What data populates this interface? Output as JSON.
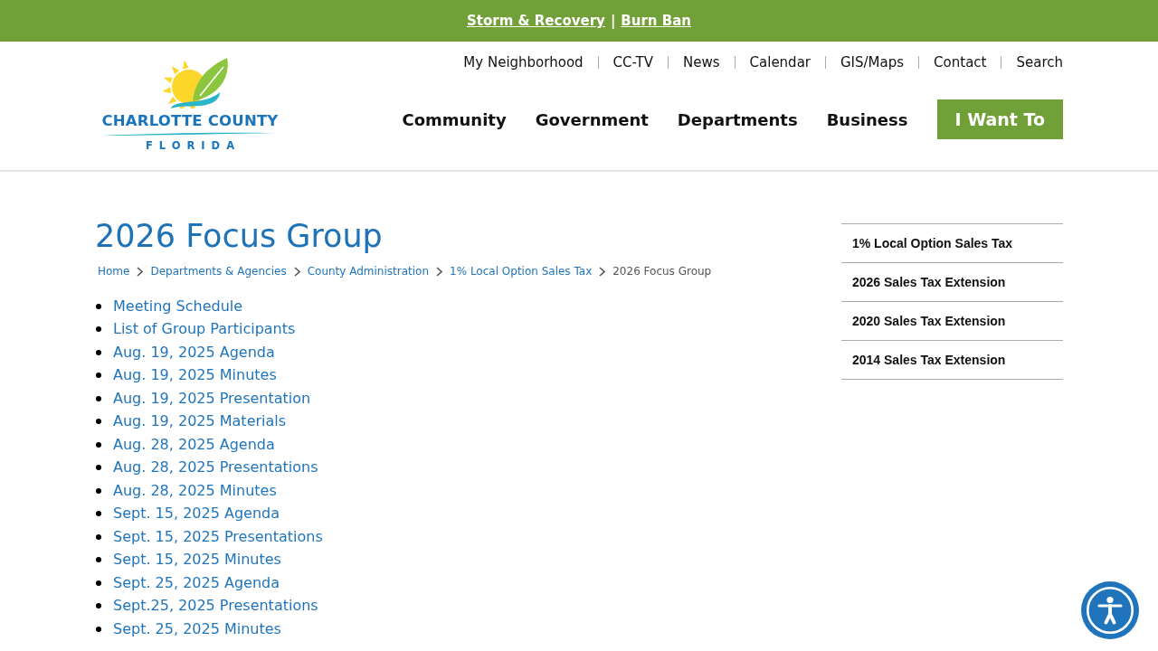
{
  "alert_bar": {
    "links": [
      "Storm & Recovery",
      "Burn Ban"
    ],
    "separator": "|"
  },
  "logo": {
    "name": "CHARLOTTE COUNTY",
    "state": "FLORIDA"
  },
  "utility_nav": [
    "My Neighborhood",
    "CC-TV",
    "News",
    "Calendar",
    "GIS/Maps",
    "Contact",
    "Search"
  ],
  "main_nav": [
    {
      "label": "Community",
      "kind": "link"
    },
    {
      "label": "Government",
      "kind": "link"
    },
    {
      "label": "Departments",
      "kind": "link"
    },
    {
      "label": "Business",
      "kind": "link"
    },
    {
      "label": "I Want To",
      "kind": "button"
    }
  ],
  "page": {
    "title": "2026 Focus Group",
    "breadcrumb": [
      {
        "label": "Home",
        "current": false
      },
      {
        "label": "Departments & Agencies",
        "current": false
      },
      {
        "label": "County Administration",
        "current": false
      },
      {
        "label": "1% Local Option Sales Tax",
        "current": false
      },
      {
        "label": "2026 Focus Group",
        "current": true
      }
    ],
    "links": [
      "Meeting Schedule",
      "List of Group Participants",
      "Aug. 19, 2025 Agenda",
      "Aug. 19, 2025 Minutes",
      "Aug. 19, 2025 Presentation",
      "Aug. 19, 2025 Materials",
      "Aug. 28, 2025 Agenda",
      "Aug. 28, 2025 Presentations",
      "Aug. 28, 2025 Minutes",
      "Sept. 15, 2025 Agenda",
      "Sept. 15, 2025 Presentations",
      "Sept. 15, 2025 Minutes",
      "Sept. 25, 2025 Agenda",
      "Sept.25, 2025 Presentations",
      "Sept. 25, 2025 Minutes"
    ]
  },
  "sidebar": {
    "items": [
      "1% Local Option Sales Tax",
      "2026 Sales Tax Extension",
      "2020 Sales Tax Extension",
      "2014 Sales Tax Extension"
    ]
  }
}
